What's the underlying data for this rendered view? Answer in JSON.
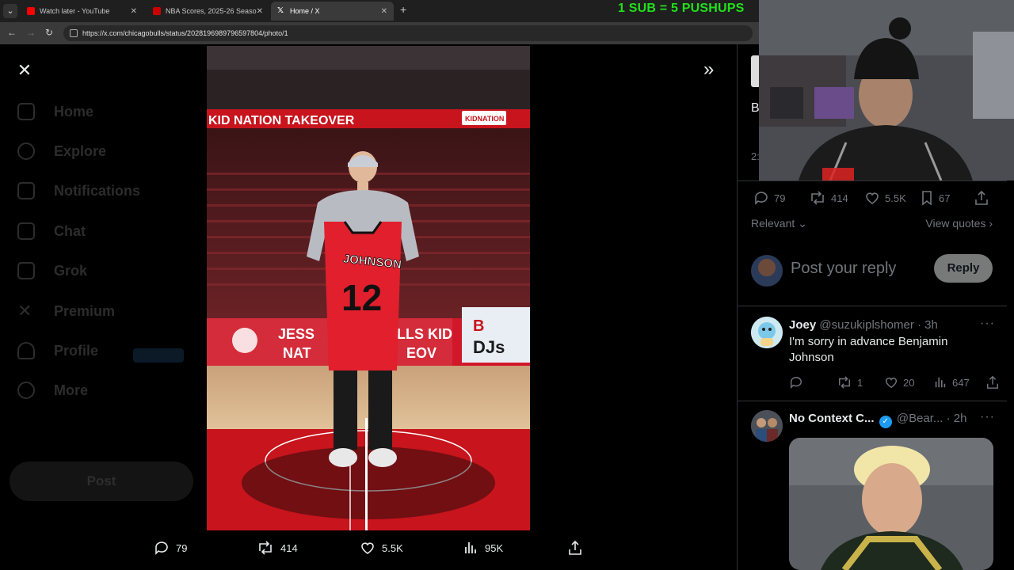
{
  "browser": {
    "tabs": [
      {
        "title": "Watch later - YouTube",
        "fav_color": "#ff0000",
        "active": false
      },
      {
        "title": "NBA Scores, 2025-26 Season - E",
        "fav_color": "#cc0000",
        "active": false
      },
      {
        "title": "Home / X",
        "fav_color": "#ffffff",
        "active": true
      }
    ],
    "url": "https://x.com/chicagobulls/status/2028196989796597804/photo/1"
  },
  "stream_overlay": {
    "banner": "1 SUB = 5 PUSHUPS"
  },
  "background_nav": [
    {
      "label": "Home",
      "icon": "home-icon"
    },
    {
      "label": "Explore",
      "icon": "search-icon"
    },
    {
      "label": "Notifications",
      "icon": "bell-icon"
    },
    {
      "label": "Chat",
      "icon": "mail-icon"
    },
    {
      "label": "Grok",
      "icon": "grok-icon"
    },
    {
      "label": "Premium",
      "icon": "x-logo-icon"
    },
    {
      "label": "Profile",
      "icon": "person-icon"
    },
    {
      "label": "More",
      "icon": "more-circle-icon"
    }
  ],
  "background_post_button": "Post",
  "photo": {
    "arena_banner": "KID NATION TAKEOVER",
    "arena_banner_logo": "KIDNATION",
    "jersey_name": "JOHNSON",
    "jersey_number": "12",
    "board_left_text": "JESS",
    "board_mid_text": "LLS KID",
    "board_line2": "NAT",
    "board_line2b": "EOV",
    "board_right_top": "B",
    "board_right_text": "DJs"
  },
  "modal_actions": {
    "replies": "79",
    "reposts": "414",
    "likes": "5.5K",
    "views": "95K"
  },
  "right_panel": {
    "partial_title": "B",
    "partial_meta": "2:",
    "stats": {
      "replies": "79",
      "reposts": "414",
      "likes": "5.5K",
      "bookmarks": "67"
    },
    "sort_label": "Relevant",
    "view_quotes": "View quotes",
    "reply_placeholder": "Post your reply",
    "reply_button": "Reply",
    "tweets": [
      {
        "name": "Joey",
        "handle": "@suzukiplshomer",
        "time": "· 3h",
        "text": "I'm sorry in advance Benjamin Johnson",
        "replies": "",
        "reposts": "1",
        "likes": "20",
        "views": "647"
      },
      {
        "name": "No Context C...",
        "handle": "@Bear...",
        "time": "· 2h",
        "verified": true
      }
    ]
  },
  "colors": {
    "x_blue": "#1d9bf0",
    "bulls_red": "#ce1141",
    "banner_green": "#22e01b"
  }
}
